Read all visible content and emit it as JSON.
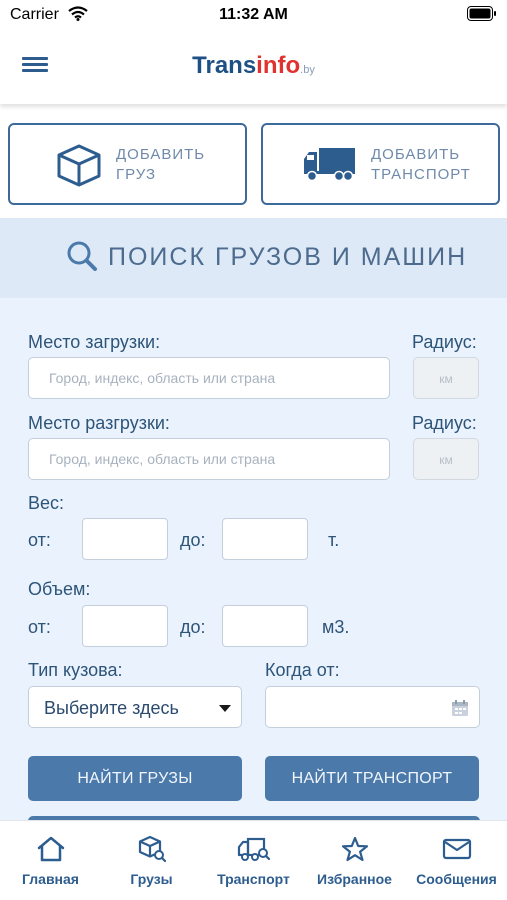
{
  "status_bar": {
    "carrier": "Carrier",
    "time": "11:32 AM"
  },
  "header": {
    "logo": {
      "part1": "Trans",
      "part2": "info",
      "suffix": ".by"
    }
  },
  "actions": {
    "add_cargo": "ДОБАВИТЬ\nГРУЗ",
    "add_transport": "ДОБАВИТЬ\nТРАНСПОРТ"
  },
  "search": {
    "title": "ПОИСК ГРУЗОВ И МАШИН",
    "loading_label": "Место загрузки:",
    "unloading_label": "Место разгрузки:",
    "radius_label": "Радиус:",
    "place_placeholder": "Город, индекс, область или страна",
    "radius_placeholder": "км",
    "weight_label": "Вес:",
    "volume_label": "Объем:",
    "from_label": "от:",
    "to_label": "до:",
    "weight_unit": "т.",
    "volume_unit": "м3.",
    "body_type_label": "Тип кузова:",
    "body_type_value": "Выберите здесь",
    "when_from_label": "Когда от:",
    "find_cargo": "НАЙТИ ГРУЗЫ",
    "find_transport": "НАЙТИ ТРАНСПОРТ"
  },
  "tab_bar": {
    "items": [
      {
        "label": "Главная",
        "icon": "home-icon"
      },
      {
        "label": "Грузы",
        "icon": "cargo-search-icon"
      },
      {
        "label": "Транспорт",
        "icon": "truck-search-icon"
      },
      {
        "label": "Избранное",
        "icon": "star-icon"
      },
      {
        "label": "Сообщения",
        "icon": "mail-icon"
      }
    ]
  },
  "colors": {
    "brand_blue": "#1e4f85",
    "brand_red": "#e0332f",
    "button_blue": "#4a79aa",
    "search_band": "#dde9f6",
    "form_background": "#eaf3fd"
  }
}
